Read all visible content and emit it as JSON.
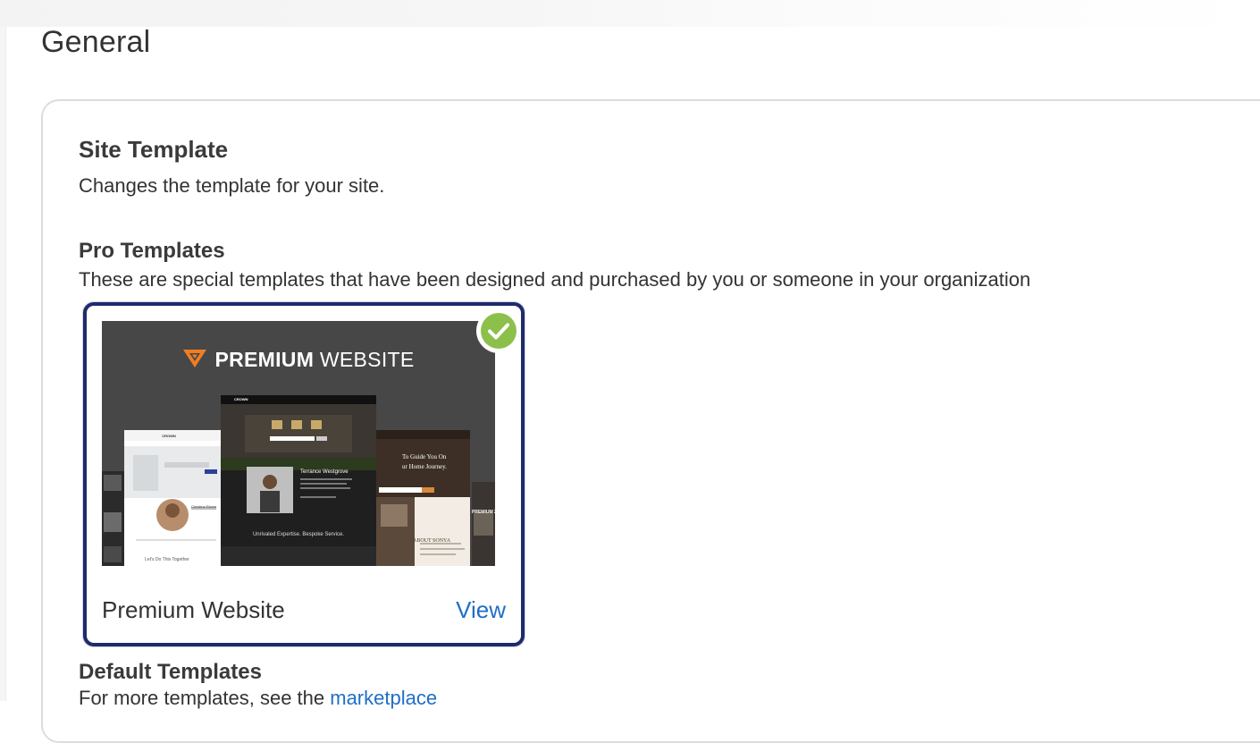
{
  "page": {
    "title": "General"
  },
  "site_template": {
    "title": "Site Template",
    "description": "Changes the template for your site."
  },
  "pro_templates": {
    "title": "Pro Templates",
    "description": "These are special templates that have been designed and purchased by you or someone in your organization",
    "items": [
      {
        "name": "Premium Website",
        "view_label": "View",
        "selected": true,
        "thumbnail": {
          "brand_bold": "PREMIUM",
          "brand_light": "WEBSITE",
          "mock_left_heading": "CROWN",
          "mock_left_name": "Christina Rivers",
          "mock_left_footer_a": "Let's Do This",
          "mock_left_footer_b": "Together",
          "mock_center_heading": "CROWN",
          "mock_center_name": "Terrance Westgrove",
          "mock_center_footer_a": "Unrivaled",
          "mock_center_footer_b": "Expertise.",
          "mock_center_footer_c": "Bespoke Service.",
          "mock_right_headline_1": "To Guide You On",
          "mock_right_headline_2": "ur Home Journey.",
          "mock_right_about": "ABOUT SONYA",
          "mock_far_right": "PREMIUM 2 OF"
        }
      }
    ]
  },
  "default_templates": {
    "title": "Default Templates",
    "description_prefix": "For more templates, see the",
    "marketplace_link": "marketplace"
  },
  "colors": {
    "accent_link": "#1f6fc5",
    "selected_border": "#1f2b6b",
    "check_green": "#8cc04b",
    "logo_orange": "#f07d22"
  },
  "icons": {
    "selected": "check-circle-icon",
    "brand": "premium-logo-icon"
  }
}
